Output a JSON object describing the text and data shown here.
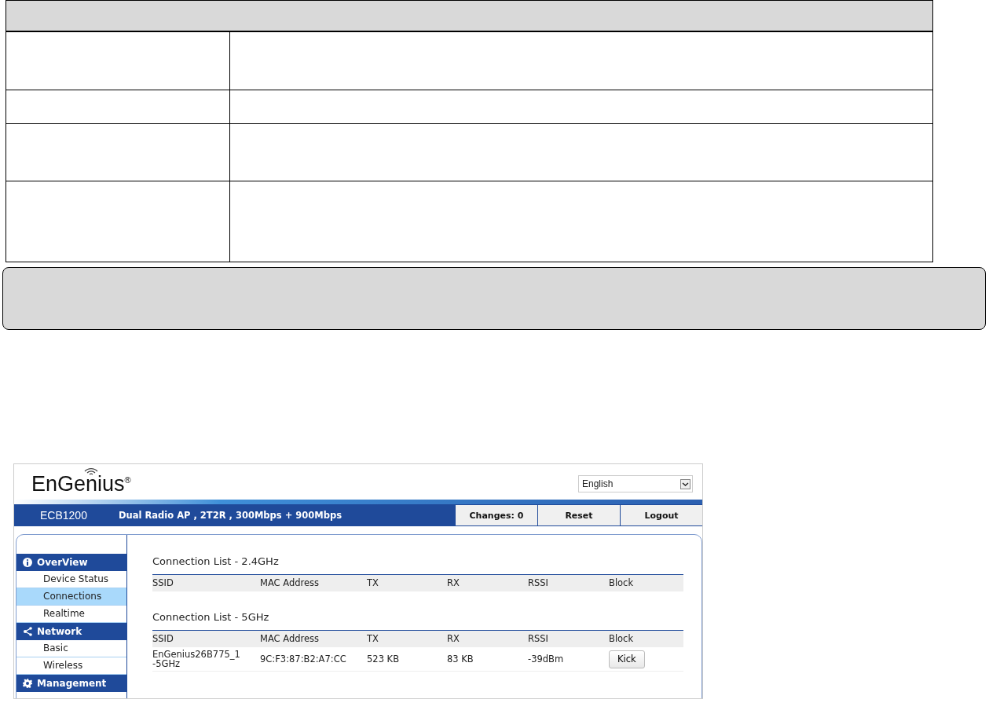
{
  "header": {
    "logo": "EnGenius",
    "logo_mark": "®",
    "language": "English",
    "model": "ECB1200",
    "description": "Dual Radio AP , 2T2R , 300Mbps + 900Mbps",
    "buttons": [
      "Changes: 0",
      "Reset",
      "Logout"
    ]
  },
  "sidebar": [
    {
      "title": "OverView",
      "kind": "info",
      "items": [
        {
          "label": "Device Status",
          "selected": false
        },
        {
          "label": "Connections",
          "selected": true
        },
        {
          "label": "Realtime",
          "selected": false
        }
      ]
    },
    {
      "title": "Network",
      "kind": "share",
      "items": [
        {
          "label": "Basic",
          "selected": false
        },
        {
          "label": "Wireless",
          "selected": false
        }
      ]
    },
    {
      "title": "Management",
      "kind": "gear"
    }
  ],
  "connection_lists": [
    {
      "title": "Connection List - 2.4GHz",
      "columns": [
        "SSID",
        "MAC Address",
        "TX",
        "RX",
        "RSSI",
        "Block"
      ]
    },
    {
      "title": "Connection List - 5GHz",
      "columns": [
        "SSID",
        "MAC Address",
        "TX",
        "RX",
        "RSSI",
        "Block"
      ],
      "rows": [
        {
          "ssid": "EnGenius26B775_1 -5GHz",
          "mac": "9C:F3:87:B2:A7:CC",
          "tx": "523 KB",
          "rx": "83 KB",
          "rssi": "-39dBm",
          "action": "Kick"
        }
      ]
    }
  ]
}
